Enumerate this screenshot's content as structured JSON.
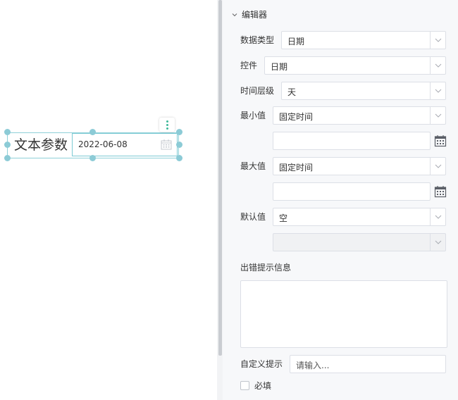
{
  "canvas": {
    "widget_label": "文本参数",
    "widget_value": "2022-06-08"
  },
  "panel": {
    "section_title": "编辑器",
    "data_type": {
      "label": "数据类型",
      "value": "日期"
    },
    "control": {
      "label": "控件",
      "value": "日期"
    },
    "time_level": {
      "label": "时间层级",
      "value": "天"
    },
    "min_value": {
      "label": "最小值",
      "value": "固定时间",
      "date": ""
    },
    "max_value": {
      "label": "最大值",
      "value": "固定时间",
      "date": ""
    },
    "default_value": {
      "label": "默认值",
      "value": "空",
      "sub_value": ""
    },
    "error_hint": {
      "label": "出错提示信息",
      "value": ""
    },
    "custom_hint": {
      "label": "自定义提示",
      "placeholder": "请输入..."
    },
    "required": {
      "label": "必填",
      "checked": false
    }
  },
  "colors": {
    "selection": "#8ccbd6",
    "accent": "#3fb99a",
    "panel_bg": "#f7f8fa",
    "border": "#dcdfe6"
  }
}
